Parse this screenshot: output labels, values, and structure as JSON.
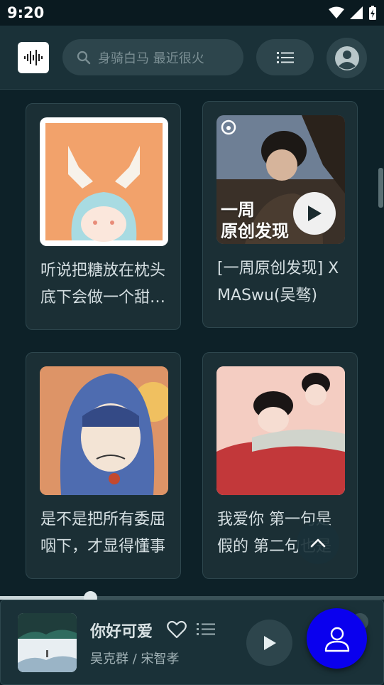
{
  "status_bar": {
    "time": "9:20",
    "icons": [
      "wifi-icon",
      "signal-icon",
      "battery-charging-icon"
    ]
  },
  "header": {
    "logo_icon": "audio-wave-icon",
    "search": {
      "icon": "search-icon",
      "placeholder": "身骑白马 最近很火"
    },
    "list_icon": "list-icon",
    "account_icon": "account-icon"
  },
  "playlists": [
    {
      "title": "听说把糖放在枕头底下会做一个甜甜的梦"
    },
    {
      "title": "[一周原创发现] XMASwu(吴骜)",
      "badge_icon": "netease-logo",
      "cover_text_line1": "一周",
      "cover_text_line2": "原创发现",
      "play_icon": "play-icon"
    },
    {
      "title": "是不是把所有委屈咽下，才显得懂事"
    },
    {
      "title": "我爱你 第一句是假的 第二句也是"
    }
  ],
  "player": {
    "song_title": "你好可爱",
    "artist": "吴克群 / 宋智孝",
    "progress": 0.235,
    "heart_icon": "heart-outline-icon",
    "queue_icon": "queue-icon",
    "play_icon": "play-icon"
  },
  "scroll_top_icon": "chevron-up-icon",
  "fab_icon": "person-icon",
  "colors": {
    "background": "#0d2128",
    "surface": "#1a3138",
    "card": "#1b2f35",
    "fab": "#0a00ee",
    "text": "#d5dfe2"
  }
}
